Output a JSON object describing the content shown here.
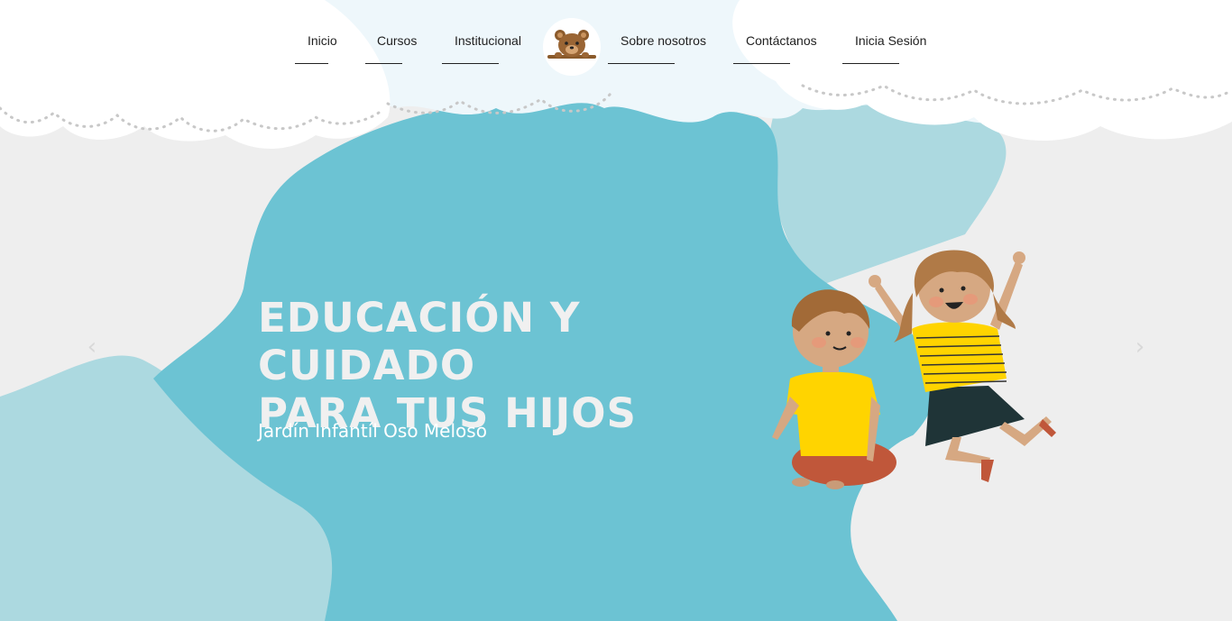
{
  "nav": {
    "items": [
      {
        "label": "Inicio"
      },
      {
        "label": "Cursos"
      },
      {
        "label": "Institucional"
      },
      {
        "label": "Sobre nosotros"
      },
      {
        "label": "Contáctanos"
      },
      {
        "label": "Inicia Sesión"
      }
    ],
    "logo_icon": "teddy-bear-icon"
  },
  "hero": {
    "title_line1": "EDUCACIÓN Y CUIDADO",
    "title_line2": "PARA TUS HIJOS",
    "subtitle": "Jardín Infantíl Oso Meloso"
  },
  "carousel": {
    "prev_icon": "chevron-left-icon",
    "next_icon": "chevron-right-icon",
    "prev_glyph": "‹",
    "next_glyph": "›"
  },
  "colors": {
    "background": "#eeeeee",
    "blob_main": "#6cc3d3",
    "blob_light": "#acd9e0",
    "cloud": "#ffffff",
    "cloud_light": "#eef7fb",
    "title_text": "#f0f0f0"
  }
}
